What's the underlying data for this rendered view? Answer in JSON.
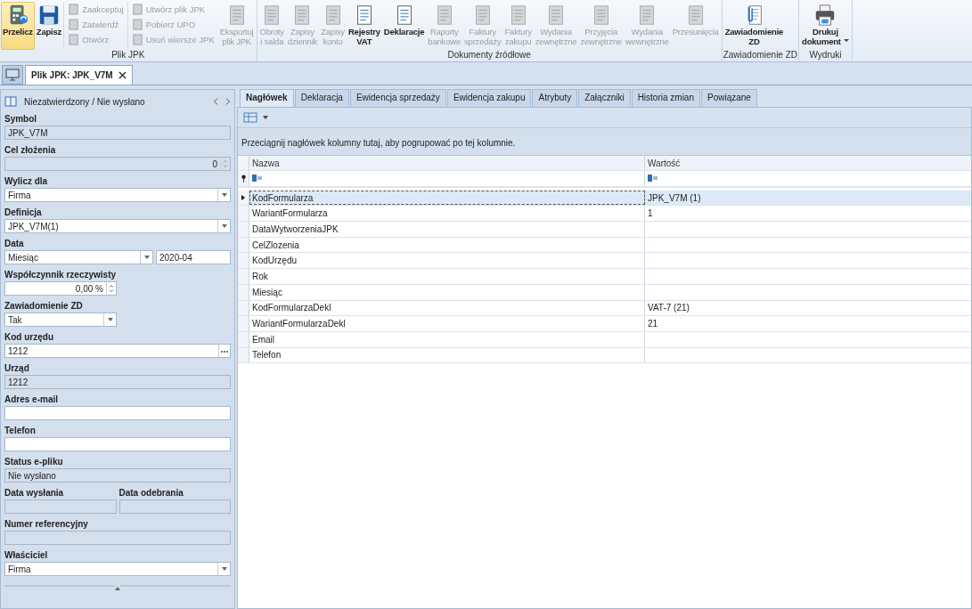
{
  "ribbon": {
    "groups": [
      {
        "label": "Plik JPK",
        "items": [
          {
            "kind": "large",
            "label": "Przelicz",
            "disabled": false,
            "selected": true
          },
          {
            "kind": "large",
            "label": "Zapisz",
            "disabled": false,
            "selected": false
          },
          {
            "kind": "stack",
            "buttons": [
              {
                "label": "Zaakceptuj",
                "disabled": true
              },
              {
                "label": "Zatwierdź",
                "disabled": true
              },
              {
                "label": "Otwórz",
                "disabled": true
              }
            ]
          },
          {
            "kind": "stack",
            "buttons": [
              {
                "label": "Utwórz plik JPK",
                "disabled": true
              },
              {
                "label": "Pobierz UPO",
                "disabled": true
              },
              {
                "label": "Usuń wiersze JPK",
                "disabled": true
              }
            ]
          },
          {
            "kind": "large",
            "label": "Eksportuj\nplik JPK",
            "disabled": true,
            "selected": false
          }
        ]
      },
      {
        "label": "Dokumenty źródłowe",
        "items": [
          {
            "kind": "large",
            "label": "Obroty\ni salda",
            "disabled": true,
            "selected": false
          },
          {
            "kind": "large",
            "label": "Zapisy\ndziennik",
            "disabled": true,
            "selected": false
          },
          {
            "kind": "large",
            "label": "Zapisy\nkonto",
            "disabled": true,
            "selected": false
          },
          {
            "kind": "large",
            "label": "Rejestry\nVAT",
            "disabled": false,
            "selected": false
          },
          {
            "kind": "large",
            "label": "Deklaracje",
            "disabled": false,
            "selected": false
          },
          {
            "kind": "large",
            "label": "Raporty\nbankowe",
            "disabled": true,
            "selected": false
          },
          {
            "kind": "large",
            "label": "Faktury\nsprzedaży",
            "disabled": true,
            "selected": false
          },
          {
            "kind": "large",
            "label": "Faktury\nzakupu",
            "disabled": true,
            "selected": false
          },
          {
            "kind": "large",
            "label": "Wydania\nzewnętrzne",
            "disabled": true,
            "selected": false
          },
          {
            "kind": "large",
            "label": "Przyjęcia\nzewnętrzne",
            "disabled": true,
            "selected": false
          },
          {
            "kind": "large",
            "label": "Wydania\nwewnętrzne",
            "disabled": true,
            "selected": false
          },
          {
            "kind": "large",
            "label": "Przesunięcia",
            "disabled": true,
            "selected": false
          }
        ]
      },
      {
        "label": "Zawiadomienie ZD",
        "items": [
          {
            "kind": "large",
            "label": "Zawiadomienie\nZD",
            "disabled": false,
            "selected": false
          }
        ]
      },
      {
        "label": "Wydruki",
        "items": [
          {
            "kind": "large",
            "label": "Drukuj\ndokument",
            "disabled": false,
            "selected": false,
            "dropdown": true
          }
        ]
      }
    ]
  },
  "document_tabs": [
    {
      "label": "Plik JPK: JPK_V7M",
      "selected": true
    }
  ],
  "form": {
    "status": "Niezatwierdzony / Nie wysłano",
    "fields": [
      {
        "kind": "readonly",
        "label": "Symbol",
        "value": "JPK_V7M"
      },
      {
        "kind": "spin",
        "label": "Cel złożenia",
        "value": "0"
      },
      {
        "kind": "select",
        "label": "Wylicz dla",
        "value": "Firma"
      },
      {
        "kind": "select",
        "label": "Definicja",
        "value": "JPK_V7M(1)"
      },
      {
        "kind": "period",
        "label": "Data",
        "value": "Miesiąc",
        "value_2": "2020-04"
      },
      {
        "kind": "percent",
        "label": "Współczynnik rzeczywisty",
        "value": "0,00 %"
      },
      {
        "kind": "select_short",
        "label": "Zawiadomienie ZD",
        "value": "Tak"
      },
      {
        "kind": "lookup",
        "label": "Kod urzędu",
        "value": "1212"
      },
      {
        "kind": "readonly",
        "label": "Urząd",
        "value": "1212"
      },
      {
        "kind": "input",
        "label": "Adres e-mail"
      },
      {
        "kind": "input",
        "label": "Telefon"
      },
      {
        "kind": "readonly",
        "label": "Status e-pliku",
        "value": "Nie wysłano"
      },
      {
        "kind": "pair",
        "label": "Data wysłania",
        "label_2": "Data odebrania"
      },
      {
        "kind": "readonly",
        "label": "Numer referencyjny"
      },
      {
        "kind": "select",
        "label": "Właściciel",
        "value": "Firma"
      }
    ]
  },
  "tabs": [
    {
      "label": "Nagłówek",
      "selected": true
    },
    {
      "label": "Deklaracja",
      "selected": false
    },
    {
      "label": "Ewidencja sprzedaży",
      "selected": false
    },
    {
      "label": "Ewidencja zakupu",
      "selected": false
    },
    {
      "label": "Atrybuty",
      "selected": false
    },
    {
      "label": "Załączniki",
      "selected": false
    },
    {
      "label": "Historia zmian",
      "selected": false
    },
    {
      "label": "Powiązane",
      "selected": false
    }
  ],
  "grid": {
    "group_hint": "Przeciągnij nagłówek kolumny tutaj, aby pogrupować po tej kolumnie.",
    "columns": [
      "Nazwa",
      "Wartość"
    ],
    "rows": [
      {
        "name": "KodFormularza",
        "value": "JPK_V7M (1)",
        "selected": true
      },
      {
        "name": "WariantFormularza",
        "value": "1",
        "selected": false
      },
      {
        "name": "DataWytworzeniaJPK",
        "selected": false
      },
      {
        "name": "CelZlozenia",
        "selected": false
      },
      {
        "name": "KodUrzędu",
        "selected": false
      },
      {
        "name": "Rok",
        "selected": false
      },
      {
        "name": "Miesiąc",
        "selected": false
      },
      {
        "name": "KodFormularzaDekl",
        "value": "VAT-7 (21)",
        "selected": false
      },
      {
        "name": "WariantFormularzaDekl",
        "value": "21",
        "selected": false
      },
      {
        "name": "Email",
        "selected": false
      },
      {
        "name": "Telefon",
        "selected": false
      }
    ]
  }
}
